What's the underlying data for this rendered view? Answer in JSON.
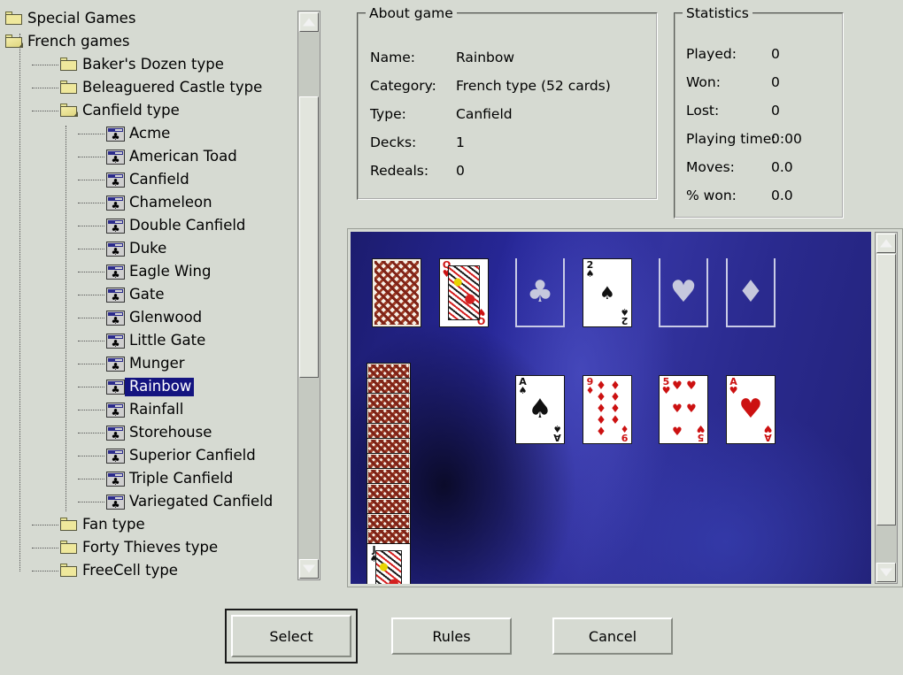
{
  "window": {
    "background_color": "#d6dad2",
    "selection_color": "#141480"
  },
  "tree": {
    "name": "game-selection-tree",
    "items": [
      {
        "label": "Special Games",
        "depth": 0,
        "kind": "folder",
        "open": false,
        "selected": false
      },
      {
        "label": "French games",
        "depth": 0,
        "kind": "folder-open",
        "open": true,
        "selected": false
      },
      {
        "label": "Baker's Dozen type",
        "depth": 1,
        "kind": "folder",
        "open": false,
        "selected": false
      },
      {
        "label": "Beleaguered Castle type",
        "depth": 1,
        "kind": "folder",
        "open": false,
        "selected": false
      },
      {
        "label": "Canfield type",
        "depth": 1,
        "kind": "folder-open",
        "open": true,
        "selected": false
      },
      {
        "label": "Acme",
        "depth": 2,
        "kind": "game",
        "open": false,
        "selected": false
      },
      {
        "label": "American Toad",
        "depth": 2,
        "kind": "game",
        "open": false,
        "selected": false
      },
      {
        "label": "Canfield",
        "depth": 2,
        "kind": "game",
        "open": false,
        "selected": false
      },
      {
        "label": "Chameleon",
        "depth": 2,
        "kind": "game",
        "open": false,
        "selected": false
      },
      {
        "label": "Double Canfield",
        "depth": 2,
        "kind": "game",
        "open": false,
        "selected": false
      },
      {
        "label": "Duke",
        "depth": 2,
        "kind": "game",
        "open": false,
        "selected": false
      },
      {
        "label": "Eagle Wing",
        "depth": 2,
        "kind": "game",
        "open": false,
        "selected": false
      },
      {
        "label": "Gate",
        "depth": 2,
        "kind": "game",
        "open": false,
        "selected": false
      },
      {
        "label": "Glenwood",
        "depth": 2,
        "kind": "game",
        "open": false,
        "selected": false
      },
      {
        "label": "Little Gate",
        "depth": 2,
        "kind": "game",
        "open": false,
        "selected": false
      },
      {
        "label": "Munger",
        "depth": 2,
        "kind": "game",
        "open": false,
        "selected": false
      },
      {
        "label": "Rainbow",
        "depth": 2,
        "kind": "game",
        "open": false,
        "selected": true
      },
      {
        "label": "Rainfall",
        "depth": 2,
        "kind": "game",
        "open": false,
        "selected": false
      },
      {
        "label": "Storehouse",
        "depth": 2,
        "kind": "game",
        "open": false,
        "selected": false
      },
      {
        "label": "Superior Canfield",
        "depth": 2,
        "kind": "game",
        "open": false,
        "selected": false
      },
      {
        "label": "Triple Canfield",
        "depth": 2,
        "kind": "game",
        "open": false,
        "selected": false
      },
      {
        "label": "Variegated Canfield",
        "depth": 2,
        "kind": "game",
        "open": false,
        "selected": false
      },
      {
        "label": "Fan type",
        "depth": 1,
        "kind": "folder",
        "open": false,
        "selected": false
      },
      {
        "label": "Forty Thieves type",
        "depth": 1,
        "kind": "folder",
        "open": false,
        "selected": false
      },
      {
        "label": "FreeCell type",
        "depth": 1,
        "kind": "folder",
        "open": false,
        "selected": false
      }
    ]
  },
  "about": {
    "legend": "About game",
    "rows": [
      {
        "key": "Name:",
        "value": "Rainbow"
      },
      {
        "key": "Category:",
        "value": "French type (52 cards)"
      },
      {
        "key": "Type:",
        "value": "Canfield"
      },
      {
        "key": "Decks:",
        "value": "1"
      },
      {
        "key": "Redeals:",
        "value": "0"
      }
    ]
  },
  "statistics": {
    "legend": "Statistics",
    "rows": [
      {
        "key": "Played:",
        "value": "0"
      },
      {
        "key": "Won:",
        "value": "0"
      },
      {
        "key": "Lost:",
        "value": "0"
      },
      {
        "key": "Playing time:",
        "value": "0:00"
      },
      {
        "key": "Moves:",
        "value": "0.0"
      },
      {
        "key": "% won:",
        "value": "0.0"
      }
    ]
  },
  "preview": {
    "name": "game-preview",
    "table_color": "#2a2a8e",
    "top_row": [
      {
        "type": "back",
        "label": "face-down stock"
      },
      {
        "type": "face",
        "rank": "Q",
        "suit": "hearts",
        "suit_glyph": "♥",
        "color": "red",
        "label": "queen-of-hearts"
      },
      {
        "type": "slot",
        "suit": "clubs",
        "suit_glyph": "♣",
        "label": "empty-foundation-clubs"
      },
      {
        "type": "face",
        "rank": "2",
        "suit": "spades",
        "suit_glyph": "♠",
        "color": "black",
        "label": "two-of-spades"
      },
      {
        "type": "slot",
        "suit": "hearts",
        "suit_glyph": "♥",
        "label": "empty-foundation-hearts"
      },
      {
        "type": "slot",
        "suit": "diamonds",
        "suit_glyph": "♦",
        "label": "empty-foundation-diamonds"
      }
    ],
    "reserve_pile": {
      "face_down_count": 12,
      "bottom_card": {
        "rank": "J",
        "suit": "spades",
        "suit_glyph": "♠",
        "color": "black",
        "label": "jack-of-spades"
      }
    },
    "tableau_row": [
      {
        "rank": "A",
        "suit": "spades",
        "suit_glyph": "♠",
        "color": "black",
        "pips": 1,
        "label": "ace-of-spades"
      },
      {
        "rank": "9",
        "suit": "diamonds",
        "suit_glyph": "♦",
        "color": "red",
        "pips": 9,
        "label": "nine-of-diamonds"
      },
      {
        "rank": "5",
        "suit": "hearts",
        "suit_glyph": "♥",
        "color": "red",
        "pips": 5,
        "label": "five-of-hearts"
      },
      {
        "rank": "A",
        "suit": "hearts",
        "suit_glyph": "♥",
        "color": "red",
        "pips": 1,
        "label": "ace-of-hearts"
      }
    ]
  },
  "buttons": {
    "select": "Select",
    "rules": "Rules",
    "cancel": "Cancel"
  }
}
